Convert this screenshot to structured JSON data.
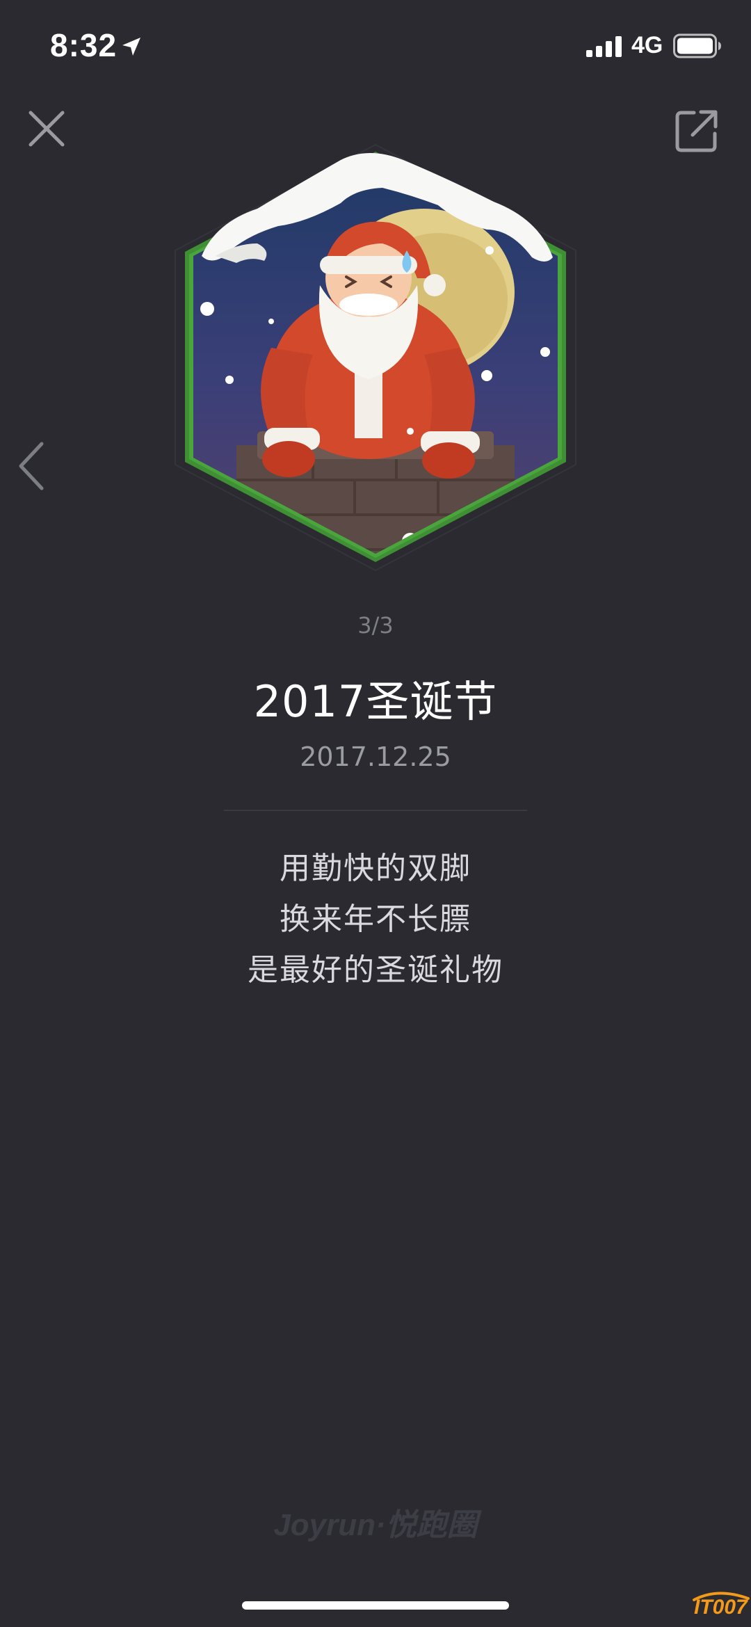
{
  "status_bar": {
    "time": "8:32",
    "network": "4G",
    "icons": [
      "location-arrow-icon",
      "signal-bars-icon",
      "battery-icon"
    ]
  },
  "header": {
    "close_icon": "close-icon",
    "share_icon": "share-external-icon",
    "prev_icon": "chevron-left-icon"
  },
  "badge": {
    "page": "3/3",
    "title": "2017圣诞节",
    "date": "2017.12.25",
    "description": [
      "用勤快的双脚",
      "换来年不长膘",
      "是最好的圣诞礼物"
    ]
  },
  "footer": {
    "brand": "Joyrun·悦跑圈",
    "corner_logo": "IT007"
  },
  "colors": {
    "background": "#2a2a30",
    "badge_frame": "#4a9e3c",
    "santa_red": "#d2492c"
  }
}
